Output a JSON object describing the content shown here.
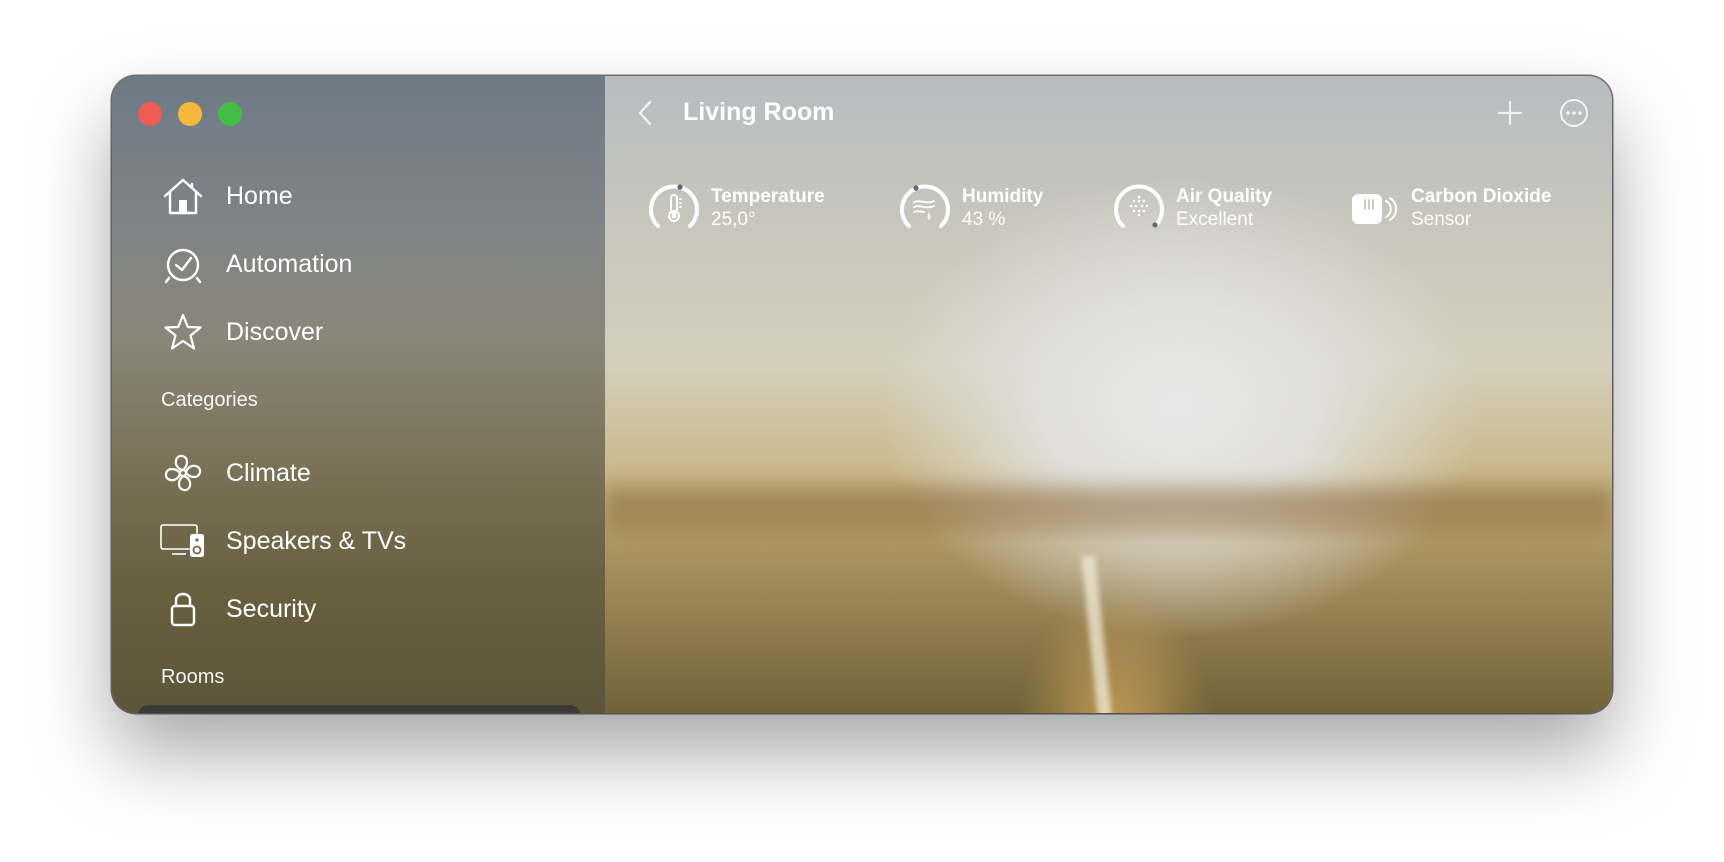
{
  "window": {
    "title": "Living Room"
  },
  "sidebar": {
    "nav": [
      {
        "label": "Home",
        "icon": "house-icon"
      },
      {
        "label": "Automation",
        "icon": "clock-check-icon"
      },
      {
        "label": "Discover",
        "icon": "star-icon"
      }
    ],
    "categories_title": "Categories",
    "categories": [
      {
        "label": "Climate",
        "icon": "fan-icon"
      },
      {
        "label": "Speakers & TVs",
        "icon": "tv-speaker-icon"
      },
      {
        "label": "Security",
        "icon": "lock-icon"
      }
    ],
    "rooms_title": "Rooms"
  },
  "header": {
    "title": "Living Room",
    "back_icon": "chevron-left-icon",
    "add_icon": "plus-icon",
    "more_icon": "ellipsis-circle-icon"
  },
  "status_tiles": [
    {
      "title": "Temperature",
      "value": "25,0°",
      "icon": "thermometer-icon"
    },
    {
      "title": "Humidity",
      "value": "43 %",
      "icon": "humidity-icon"
    },
    {
      "title": "Air Quality",
      "value": "Excellent",
      "icon": "air-quality-icon"
    },
    {
      "title": "Carbon Dioxide",
      "value": "Sensor",
      "icon": "co2-sensor-icon"
    }
  ],
  "colors": {
    "close": "#ee5c55",
    "minimize": "#f5b83a",
    "maximize": "#42bd45",
    "text": "#ffffff"
  }
}
